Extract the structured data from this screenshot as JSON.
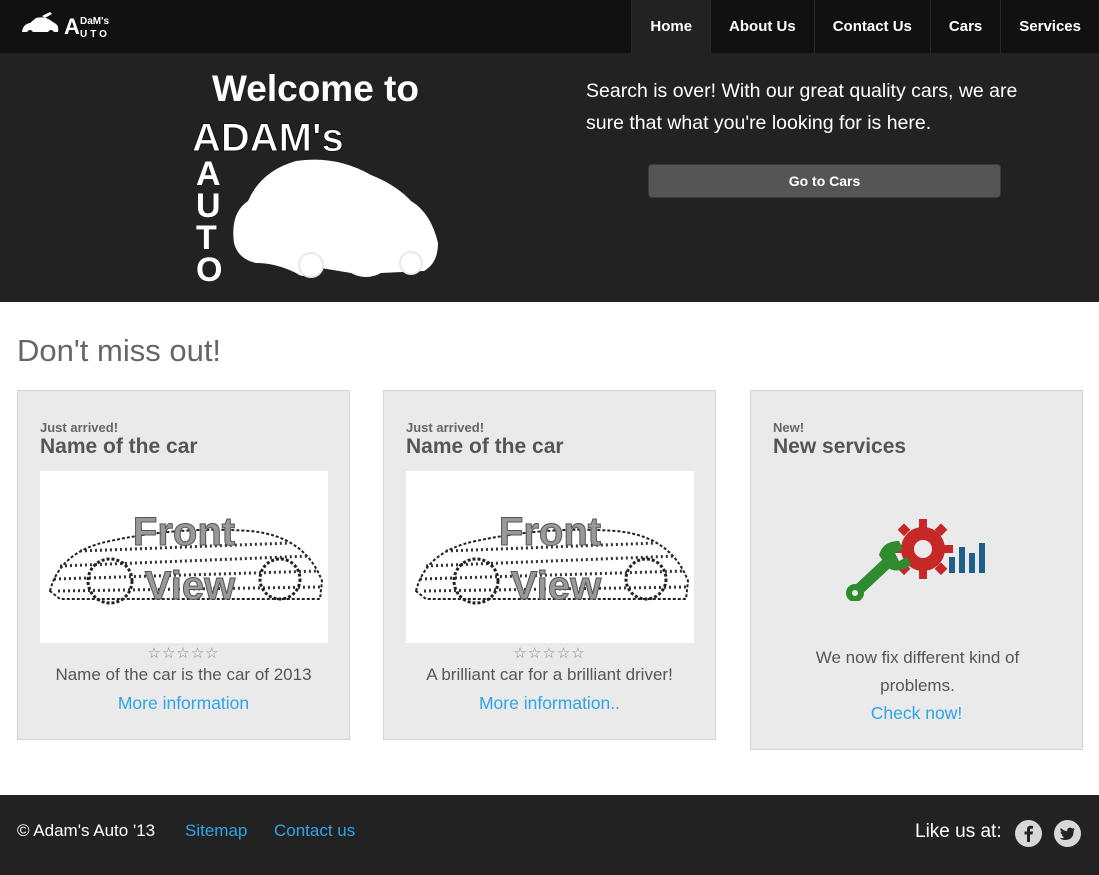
{
  "nav": {
    "brand_name": "Adam's Auto",
    "items": [
      {
        "label": "Home",
        "active": true
      },
      {
        "label": "About Us"
      },
      {
        "label": "Contact Us"
      },
      {
        "label": "Cars"
      },
      {
        "label": "Services"
      }
    ]
  },
  "hero": {
    "title": "Welcome to",
    "logo_text_main": "ADAM's",
    "logo_text_vertical": "AUTO",
    "text": "Search is over! With our great quality cars, we are sure that what you're looking for is here.",
    "button_label": "Go to Cars"
  },
  "section": {
    "heading": "Don't miss out!"
  },
  "cards": [
    {
      "kicker": "Just arrived!",
      "title": "Name of the car",
      "image_text_1": "Front",
      "image_text_2": "View",
      "stars": "☆☆☆☆☆",
      "rating": 0,
      "desc": "Name of the car is the car of 2013",
      "link": "More information"
    },
    {
      "kicker": "Just arrived!",
      "title": "Name of the car",
      "image_text_1": "Front",
      "image_text_2": "View",
      "stars": "☆☆☆☆☆",
      "rating": 0,
      "desc": "A brilliant car for a brilliant driver!",
      "link": "More information.."
    },
    {
      "kicker": "New!",
      "title": "New services",
      "desc": "We now fix different kind of problems.",
      "link": "Check now!"
    }
  ],
  "footer": {
    "copyright": "© Adam's Auto '13",
    "sitemap": "Sitemap",
    "contact": "Contact us",
    "like_us": "Like us at:"
  },
  "colors": {
    "link": "#2fa4e7",
    "navbar": "#111111",
    "hero_bg": "#222222",
    "card_bg": "#eaeaea",
    "wrench": "#2e8b2e",
    "gear": "#c62828",
    "bars": "#1f5f8b"
  },
  "icons": [
    "car-logo-icon",
    "wrench-icon",
    "gear-icon",
    "bar-chart-icon",
    "facebook-icon",
    "twitter-icon",
    "star-icon"
  ]
}
